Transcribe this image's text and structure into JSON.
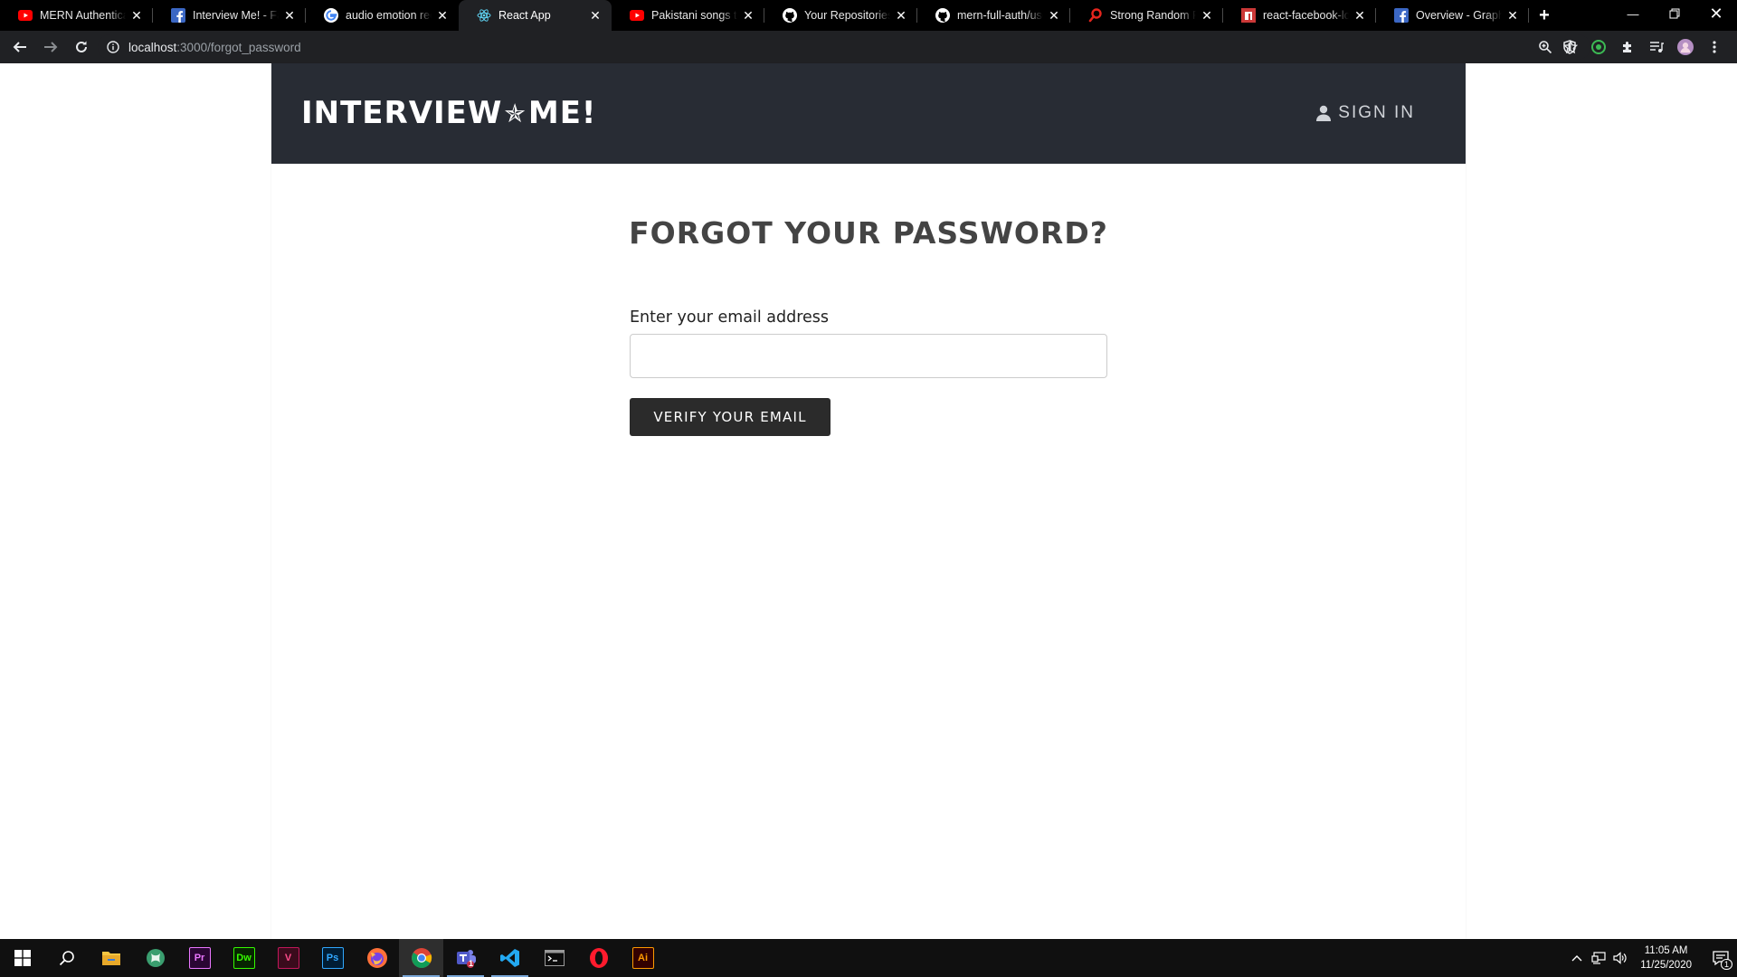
{
  "browser": {
    "tabs": [
      {
        "title": "MERN Authenticati",
        "favicon": "youtube-icon"
      },
      {
        "title": "Interview Me! - Face",
        "favicon": "facebook-icon"
      },
      {
        "title": "audio emotion reco",
        "favicon": "google-icon"
      },
      {
        "title": "React App",
        "favicon": "react-icon",
        "active": true
      },
      {
        "title": "Pakistani songs to li",
        "favicon": "youtube-icon"
      },
      {
        "title": "Your Repositories",
        "favicon": "github-icon"
      },
      {
        "title": "mern-full-auth/user",
        "favicon": "github-icon"
      },
      {
        "title": "Strong Random Pas",
        "favicon": "password-generator-icon"
      },
      {
        "title": "react-facebook-log",
        "favicon": "npm-icon"
      },
      {
        "title": "Overview - Graph A",
        "favicon": "facebook-icon"
      }
    ],
    "new_tab": "+",
    "url_host": "localhost",
    "url_path": ":3000/forgot_password"
  },
  "app": {
    "brand_left": "INTERVIEW",
    "brand_star": "✯",
    "brand_right": "ME!",
    "signin_label": "SIGN IN"
  },
  "page": {
    "heading": "FORGOT YOUR PASSWORD?",
    "email_label": "Enter your email address",
    "email_value": "",
    "email_placeholder": "",
    "verify_button": "VERIFY YOUR EMAIL"
  },
  "taskbar": {
    "apps": [
      "windows-start-icon",
      "search-icon",
      "file-explorer-icon",
      "krita-icon",
      "premiere-pro-icon",
      "dreamweaver-icon",
      "vegas-icon",
      "photoshop-icon",
      "firefox-icon",
      "chrome-icon",
      "teams-icon",
      "vscode-icon",
      "terminal-icon",
      "opera-icon",
      "illustrator-icon"
    ],
    "time": "11:05 AM",
    "date": "11/25/2020",
    "notification_count": "1",
    "teams_badge": "1"
  },
  "colors": {
    "header_bg": "#282c34",
    "button_bg": "#2b2b2b",
    "heading_text": "#444444"
  }
}
